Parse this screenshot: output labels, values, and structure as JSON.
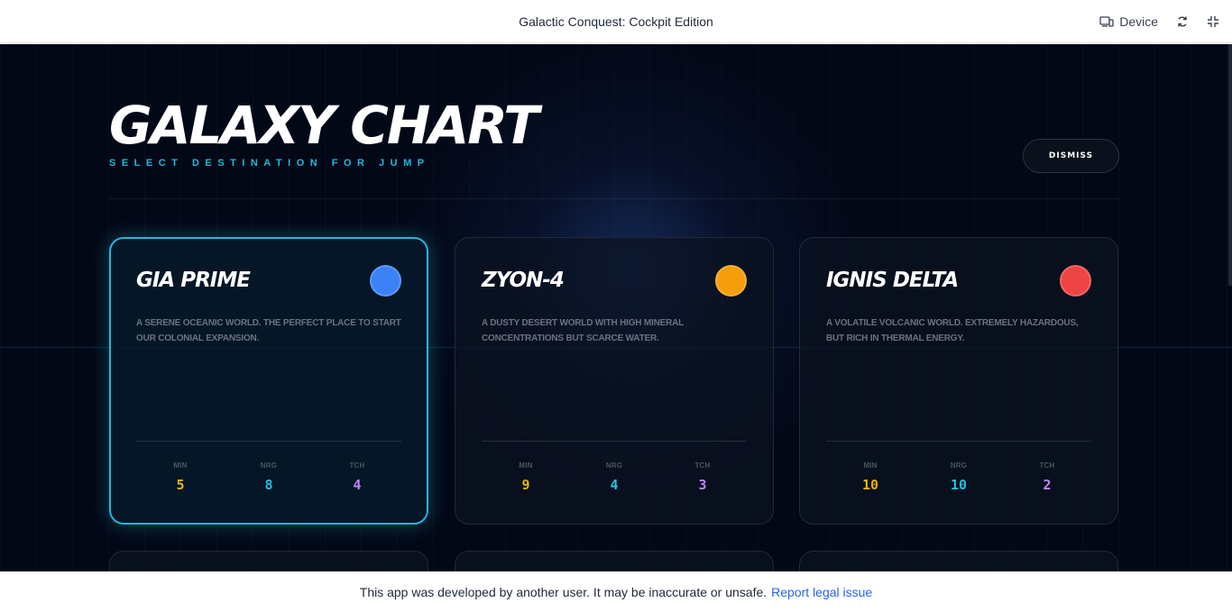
{
  "topbar": {
    "title": "Galactic Conquest: Cockpit Edition",
    "device_label": "Device"
  },
  "header": {
    "title": "GALAXY CHART",
    "subtitle": "SELECT DESTINATION FOR JUMP",
    "dismiss_label": "DISMISS"
  },
  "stat_labels": {
    "min": "MIN",
    "nrg": "NRG",
    "tch": "TCH"
  },
  "colors": {
    "accent": "#22b8d8",
    "min": "#eab308",
    "nrg": "#22c3e0",
    "tch": "#c084fc",
    "background": "#030817"
  },
  "planets": [
    {
      "name": "GIA PRIME",
      "description": "A SERENE OCEANIC WORLD. THE PERFECT PLACE TO START OUR COLONIAL EXPANSION.",
      "orb_color": "#3b82f6",
      "selected": true,
      "min": "5",
      "nrg": "8",
      "tch": "4"
    },
    {
      "name": "ZYON-4",
      "description": "A DUSTY DESERT WORLD WITH HIGH MINERAL CONCENTRATIONS BUT SCARCE WATER.",
      "orb_color": "#f59e0b",
      "selected": false,
      "min": "9",
      "nrg": "4",
      "tch": "3"
    },
    {
      "name": "IGNIS DELTA",
      "description": "A VOLATILE VOLCANIC WORLD. EXTREMELY HAZARDOUS, BUT RICH IN THERMAL ENERGY.",
      "orb_color": "#ef4444",
      "selected": false,
      "min": "10",
      "nrg": "10",
      "tch": "2"
    }
  ],
  "footer": {
    "notice": "This app was developed by another user. It may be inaccurate or unsafe.",
    "link": "Report legal issue"
  }
}
